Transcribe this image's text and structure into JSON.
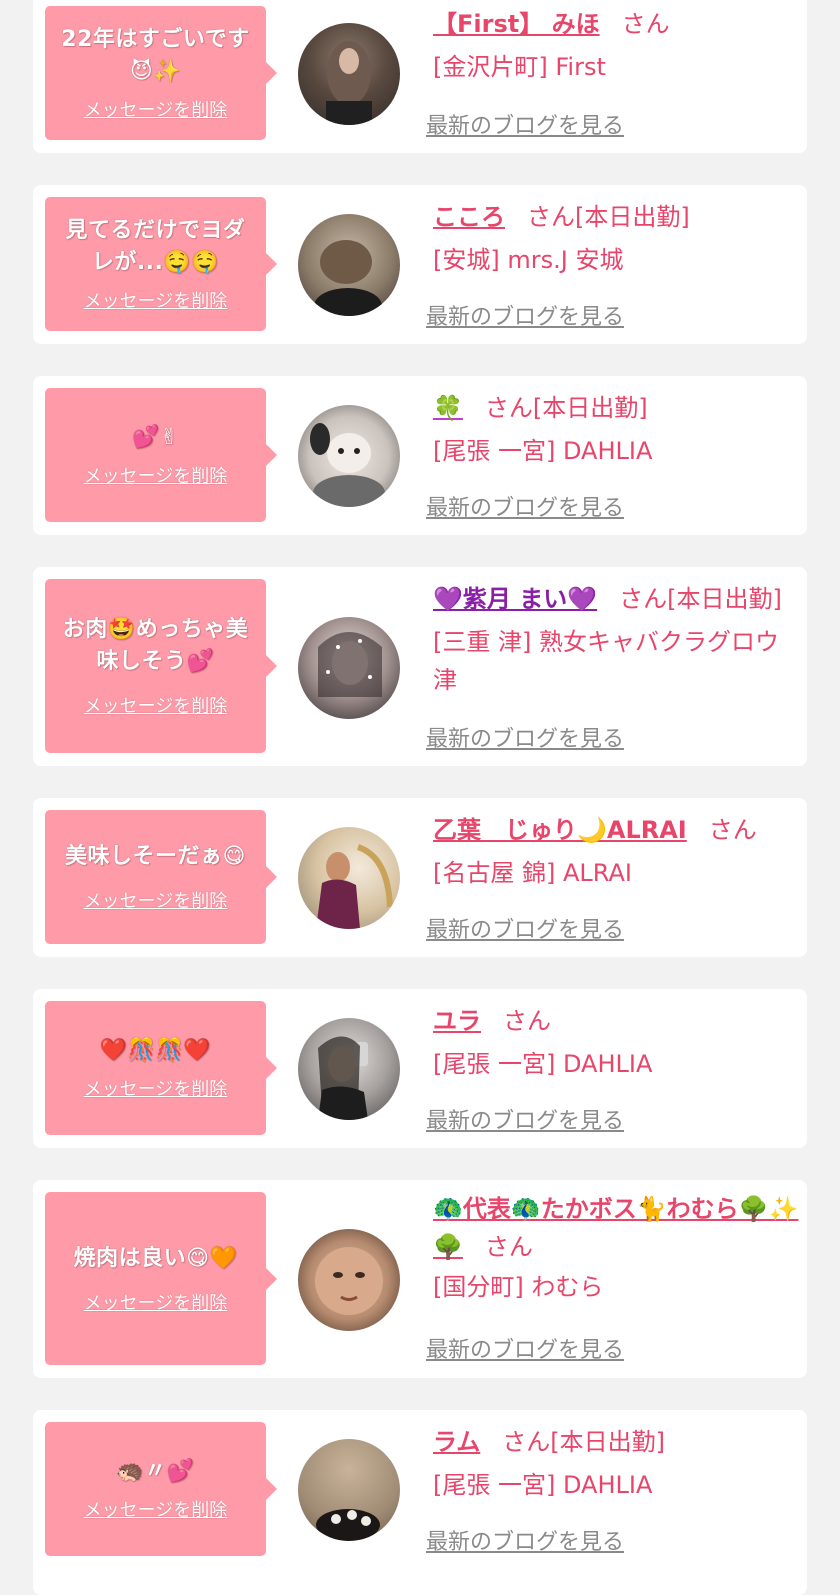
{
  "colors": {
    "page_background": "#f2f2f2",
    "card_background": "#ffffff",
    "bubble_background": "#ff9aa8",
    "accent_pink": "#e8456b",
    "blog_link_gray": "#8a8a8a"
  },
  "cards": [
    {
      "message_line1": "22年はすごいです",
      "message_line2": "😈✨",
      "delete_label": "メッセージを削除",
      "name": "【First】 みほ",
      "suffix": "さん",
      "shop": "[金沢片町] First",
      "shop2": "",
      "blog_label": "最新のブログを見る",
      "avatar_icon": "woman-wavy-hair-photo"
    },
    {
      "message_line1": "見てるだけでヨダ",
      "message_line2": "レが...🤤🤤",
      "delete_label": "メッセージを削除",
      "name": "こころ",
      "suffix": "さん[本日出勤]",
      "shop": "[安城] mrs.J 安城",
      "shop2": "",
      "blog_label": "最新のブログを見る",
      "avatar_icon": "updo-hairstyle-photo"
    },
    {
      "message_line1": "",
      "message_line2": "💕✌",
      "delete_label": "メッセージを削除",
      "name": "🍀",
      "suffix": "さん[本日出勤]",
      "shop": "[尾張 一宮] DAHLIA",
      "shop2": "",
      "blog_label": "最新のブログを見る",
      "avatar_icon": "hamster-face-photo"
    },
    {
      "message_line1": "お肉🤩めっちゃ美",
      "message_line2": "味しそう💕",
      "delete_label": "メッセージを削除",
      "name": "💜紫月 まい💜",
      "suffix": "さん[本日出勤]",
      "shop": "[三重 津] 熟女キャバクラグロウ",
      "shop2": "津",
      "blog_label": "最新のブログを見る",
      "avatar_icon": "sparkle-portrait-photo"
    },
    {
      "message_line1": "美味しそーだぁ😋",
      "message_line2": "",
      "delete_label": "メッセージを削除",
      "name": "乙葉　じゅり🌙ALRAI",
      "suffix": "さん",
      "shop": "[名古屋 錦] ALRAI",
      "shop2": "",
      "blog_label": "最新のブログを見る",
      "avatar_icon": "woman-on-chair-photo"
    },
    {
      "message_line1": "",
      "message_line2": "❤️🎊🎊❤️",
      "delete_label": "メッセージを削除",
      "name": "ユラ",
      "suffix": "さん",
      "shop": "[尾張 一宮] DAHLIA",
      "shop2": "",
      "blog_label": "最新のブログを見る",
      "avatar_icon": "mirror-selfie-photo"
    },
    {
      "message_line1": "焼肉は良い😋🧡",
      "message_line2": "",
      "delete_label": "メッセージを削除",
      "name": "🦚代表🦚たかボス🐈わむら🌳✨🌳",
      "suffix": "さん",
      "shop": "[国分町] わむら",
      "shop2": "",
      "blog_label": "最新のブログを見る",
      "avatar_icon": "melon-face-photo"
    },
    {
      "message_line1": "",
      "message_line2": "🦔〃💕",
      "delete_label": "メッセージを削除",
      "name": "ラム",
      "suffix": "さん[本日出勤]",
      "shop": "[尾張 一宮] DAHLIA",
      "shop2": "",
      "blog_label": "最新のブログを見る",
      "avatar_icon": "hair-accessory-photo"
    }
  ]
}
